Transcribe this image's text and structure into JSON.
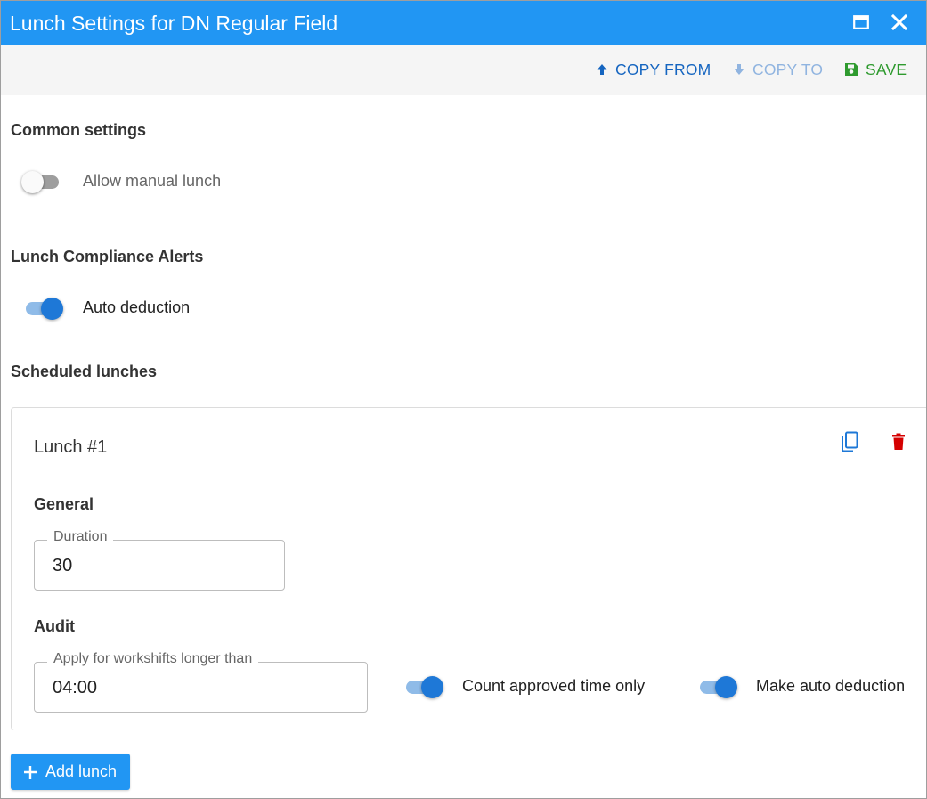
{
  "window": {
    "title": "Lunch Settings for DN Regular Field",
    "maximize_icon": "maximize-icon",
    "close_icon": "close-icon"
  },
  "toolbar": {
    "copy_from_label": "COPY FROM",
    "copy_to_label": "COPY TO",
    "save_label": "SAVE",
    "copy_from_icon": "arrow-up-icon",
    "copy_to_icon": "arrow-down-icon",
    "save_icon": "floppy-icon",
    "copy_to_disabled": true
  },
  "common_settings": {
    "title": "Common settings",
    "allow_manual_lunch": {
      "label": "Allow manual lunch",
      "checked": false
    }
  },
  "compliance_alerts": {
    "title": "Lunch Compliance Alerts",
    "auto_deduction": {
      "label": "Auto deduction",
      "checked": true
    }
  },
  "scheduled_lunches": {
    "title": "Scheduled lunches",
    "items": [
      {
        "title": "Lunch #1",
        "copy_icon": "copy-icon",
        "delete_icon": "trash-icon",
        "general_title": "General",
        "duration": {
          "label": "Duration",
          "value": "30"
        },
        "audit_title": "Audit",
        "apply_longer_than": {
          "label": "Apply for workshifts longer than",
          "value": "04:00"
        },
        "count_approved_time_only": {
          "label": "Count approved time only",
          "checked": true
        },
        "make_auto_deduction": {
          "label": "Make auto deduction",
          "checked": true
        }
      }
    ]
  },
  "add_lunch": {
    "label": "Add lunch",
    "icon": "plus-icon"
  },
  "colors": {
    "primary": "#2196f3",
    "link": "#1565c0",
    "save": "#2e9a2e",
    "delete": "#d50000",
    "switch_on": "#1e78d7"
  }
}
